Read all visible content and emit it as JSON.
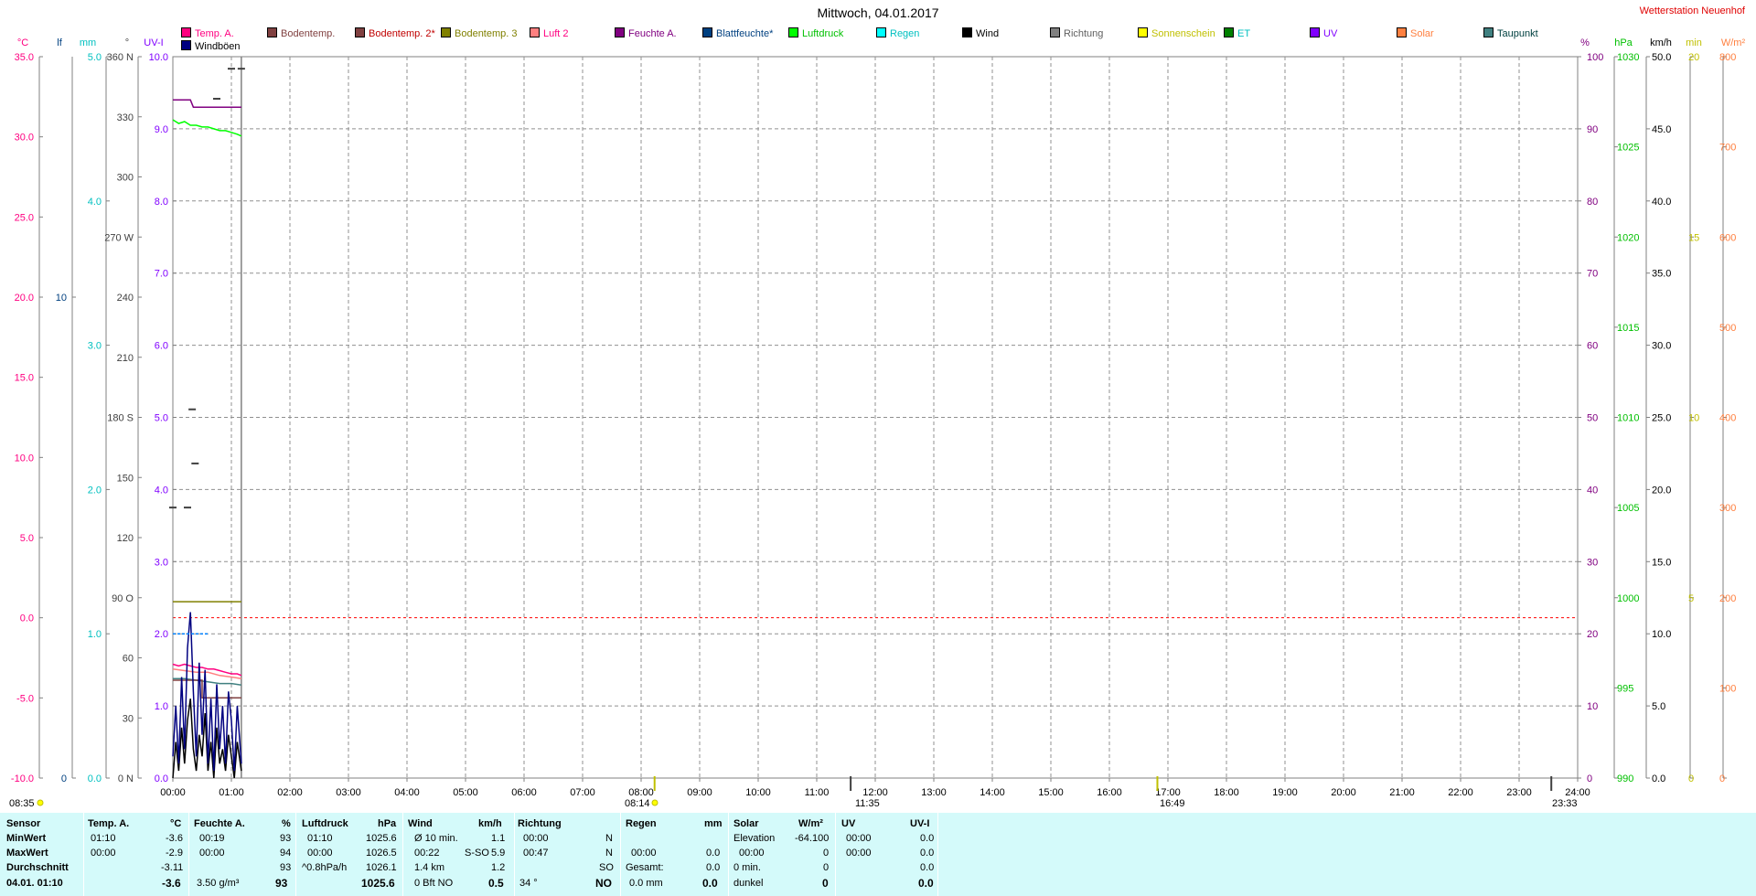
{
  "title": "Mittwoch, 04.01.2017",
  "station": "Wetterstation Neuenhof",
  "legend": [
    {
      "label": "Temp. A.",
      "color": "#ff0080",
      "text_color": "#ff0080"
    },
    {
      "label": "Windböen",
      "color": "#000080",
      "text_color": "#000000"
    },
    {
      "label": "Bodentemp.",
      "color": "#804040",
      "text_color": "#804040"
    },
    {
      "label": "Bodentemp. 2*",
      "color": "#804040",
      "text_color": "#c00000"
    },
    {
      "label": "Bodentemp. 3",
      "color": "#808000",
      "text_color": "#808000"
    },
    {
      "label": "Luft 2",
      "color": "#ff8080",
      "text_color": "#ff0080"
    },
    {
      "label": "Feuchte A.",
      "color": "#800080",
      "text_color": "#800080"
    },
    {
      "label": "Blattfeuchte*",
      "color": "#004080",
      "text_color": "#004080"
    },
    {
      "label": "Luftdruck",
      "color": "#00ff00",
      "text_color": "#00c000"
    },
    {
      "label": "Regen",
      "color": "#00ffff",
      "text_color": "#00c0c0"
    },
    {
      "label": "Wind",
      "color": "#000000",
      "text_color": "#000000"
    },
    {
      "label": "Richtung",
      "color": "#808080",
      "text_color": "#606060"
    },
    {
      "label": "Sonnenschein",
      "color": "#ffff00",
      "text_color": "#c0c000"
    },
    {
      "label": "ET",
      "color": "#008000",
      "text_color": "#00c0c0"
    },
    {
      "label": "UV",
      "color": "#8000ff",
      "text_color": "#8000ff"
    },
    {
      "label": "Solar",
      "color": "#ff8040",
      "text_color": "#ff8040"
    },
    {
      "label": "Taupunkt",
      "color": "#408080",
      "text_color": "#004040"
    }
  ],
  "axes": {
    "temp": {
      "unit": "°C",
      "ticks": [
        "35.0",
        "30.0",
        "25.0",
        "20.0",
        "15.0",
        "10.0",
        "5.0",
        "0.0",
        "-5.0",
        "-10.0"
      ],
      "color": "#ff0080"
    },
    "lf": {
      "unit": "lf",
      "ticks": [
        "10",
        "0"
      ],
      "color": "#004080"
    },
    "rain": {
      "unit": "mm",
      "ticks": [
        "5.0",
        "4.0",
        "3.0",
        "2.0",
        "1.0",
        "0.0"
      ],
      "color": "#00c0c0"
    },
    "dir": {
      "unit": "°",
      "ticks": [
        "360 N",
        "330",
        "300",
        "270 W",
        "240",
        "210",
        "180 S",
        "150",
        "120",
        "90 O",
        "60",
        "30",
        "0 N"
      ],
      "color": "#404040"
    },
    "uvi": {
      "unit": "UV-I",
      "ticks": [
        "10.0",
        "9.0",
        "8.0",
        "7.0",
        "6.0",
        "5.0",
        "4.0",
        "3.0",
        "2.0",
        "1.0",
        "0.0"
      ],
      "color": "#8000ff"
    },
    "hum": {
      "unit": "%",
      "ticks": [
        "100",
        "90",
        "80",
        "70",
        "60",
        "50",
        "40",
        "30",
        "20",
        "10",
        "0"
      ],
      "color": "#800080"
    },
    "press": {
      "unit": "hPa",
      "ticks": [
        "1030",
        "1025",
        "1020",
        "1015",
        "1010",
        "1005",
        "1000",
        "995",
        "990"
      ],
      "color": "#00c000"
    },
    "wind": {
      "unit": "km/h",
      "ticks": [
        "50.0",
        "45.0",
        "40.0",
        "35.0",
        "30.0",
        "25.0",
        "20.0",
        "15.0",
        "10.0",
        "5.0",
        "0.0"
      ],
      "color": "#000000"
    },
    "sun": {
      "unit": "min",
      "ticks": [
        "20",
        "15",
        "10",
        "5",
        "0"
      ],
      "color": "#c0c000"
    },
    "solar": {
      "unit": "W/m²",
      "ticks": [
        "800",
        "700",
        "600",
        "500",
        "400",
        "300",
        "200",
        "100",
        "0"
      ],
      "color": "#ff8040"
    }
  },
  "time_ticks": [
    "00:00",
    "01:00",
    "02:00",
    "03:00",
    "04:00",
    "05:00",
    "06:00",
    "07:00",
    "08:00",
    "09:00",
    "10:00",
    "11:00",
    "12:00",
    "13:00",
    "14:00",
    "15:00",
    "16:00",
    "17:00",
    "18:00",
    "19:00",
    "20:00",
    "21:00",
    "22:00",
    "23:00",
    "24:00"
  ],
  "time_markers": {
    "left": "08:35",
    "sunrise": "08:14",
    "noon": "11:35",
    "sunset": "16:49",
    "right": "23:33"
  },
  "chart_data": {
    "type": "line",
    "x_unit": "hours",
    "xlim": [
      0,
      24
    ],
    "now_hours": 1.17,
    "frost_line_celsius": 0.0,
    "series": [
      {
        "name": "Temp. A.",
        "axis": "temp",
        "color": "#ff0080",
        "x": [
          0,
          0.1,
          0.2,
          0.3,
          0.4,
          0.5,
          0.6,
          0.7,
          0.8,
          0.9,
          1.0,
          1.1,
          1.17
        ],
        "y": [
          -2.9,
          -3.0,
          -2.9,
          -3.0,
          -3.1,
          -3.1,
          -3.2,
          -3.2,
          -3.3,
          -3.4,
          -3.5,
          -3.5,
          -3.6
        ]
      },
      {
        "name": "Luft 2",
        "axis": "temp",
        "color": "#ff8080",
        "x": [
          0,
          0.2,
          0.4,
          0.6,
          0.8,
          1.0,
          1.17
        ],
        "y": [
          -3.2,
          -3.3,
          -3.4,
          -3.4,
          -3.6,
          -3.7,
          -3.8
        ]
      },
      {
        "name": "Taupunkt",
        "axis": "temp",
        "color": "#408080",
        "x": [
          0,
          0.2,
          0.4,
          0.6,
          0.8,
          1.0,
          1.17
        ],
        "y": [
          -3.8,
          -3.8,
          -3.9,
          -4.0,
          -4.1,
          -4.1,
          -4.2
        ]
      },
      {
        "name": "Bodentemp.",
        "axis": "temp",
        "color": "#804040",
        "x": [
          0,
          0.5,
          0.5,
          1.17
        ],
        "y": [
          -3.9,
          -3.9,
          -5.0,
          -5.0
        ]
      },
      {
        "name": "Bodentemp. 3",
        "axis": "temp",
        "color": "#808000",
        "x": [
          0,
          1.17
        ],
        "y": [
          1.0,
          1.0
        ]
      },
      {
        "name": "Feuchte A.",
        "axis": "hum",
        "color": "#800080",
        "x": [
          0,
          0.3,
          0.35,
          0.8,
          1.17
        ],
        "y": [
          94,
          94,
          93,
          93,
          93
        ]
      },
      {
        "name": "Luftdruck",
        "axis": "press",
        "color": "#00ff00",
        "x": [
          0,
          0.1,
          0.2,
          0.3,
          0.4,
          0.5,
          0.6,
          0.7,
          0.8,
          0.9,
          1.0,
          1.1,
          1.17
        ],
        "y": [
          1026.5,
          1026.3,
          1026.4,
          1026.2,
          1026.2,
          1026.1,
          1026.1,
          1026.0,
          1025.9,
          1025.9,
          1025.8,
          1025.7,
          1025.6
        ]
      },
      {
        "name": "Wind",
        "axis": "wind",
        "color": "#000000",
        "x": [
          0,
          0.05,
          0.1,
          0.15,
          0.2,
          0.25,
          0.3,
          0.35,
          0.4,
          0.45,
          0.5,
          0.55,
          0.6,
          0.65,
          0.7,
          0.75,
          0.8,
          0.85,
          0.9,
          0.95,
          1.0,
          1.05,
          1.1,
          1.17
        ],
        "y": [
          0,
          2.5,
          0.5,
          3.5,
          1.0,
          4.0,
          5.5,
          2.0,
          0.5,
          3.0,
          1.5,
          4.5,
          0.5,
          2.5,
          0,
          3.5,
          1.0,
          2.0,
          0.5,
          3.0,
          1.5,
          0,
          2.5,
          0.5
        ]
      },
      {
        "name": "Windböen",
        "axis": "wind",
        "color": "#000080",
        "x": [
          0,
          0.05,
          0.1,
          0.15,
          0.2,
          0.25,
          0.3,
          0.35,
          0.4,
          0.45,
          0.5,
          0.55,
          0.6,
          0.65,
          0.7,
          0.75,
          0.8,
          0.85,
          0.9,
          0.95,
          1.0,
          1.05,
          1.1,
          1.17
        ],
        "y": [
          1.5,
          5.0,
          1.0,
          7.0,
          2.0,
          9.0,
          11.5,
          6.0,
          1.5,
          8.0,
          3.0,
          7.5,
          1.0,
          5.5,
          0.5,
          6.5,
          2.0,
          5.0,
          1.0,
          6.0,
          4.0,
          0.5,
          5.0,
          1.0
        ]
      },
      {
        "name": "Richtung",
        "axis": "dir",
        "color": "#404040",
        "points": [
          [
            0,
            135
          ],
          [
            0.25,
            135
          ],
          [
            0.33,
            184
          ],
          [
            0.38,
            157
          ],
          [
            0.75,
            339
          ],
          [
            1.0,
            354
          ],
          [
            1.17,
            354
          ]
        ]
      },
      {
        "name": "Regen",
        "axis": "rain",
        "color": "#0080ff",
        "x": [
          0,
          0.6
        ],
        "y": [
          1.0,
          1.0
        ]
      }
    ]
  },
  "info": {
    "col_sensor": {
      "header": "Sensor",
      "min": "MinWert",
      "max": "MaxWert",
      "avg": "Durchschnitt",
      "now": "04.01. 01:10"
    },
    "temp": {
      "header": "Temp. A.",
      "unit": "°C",
      "min_time": "01:10",
      "min_val": "-3.6",
      "max_time": "00:00",
      "max_val": "-2.9",
      "avg_val": "-3.11",
      "now_val": "-3.6"
    },
    "hum": {
      "header": "Feuchte A.",
      "unit": "%",
      "min_time": "00:19",
      "min_val": "93",
      "max_time": "00:00",
      "max_val": "94",
      "avg_val": "93",
      "abs_hum": "3.50 g/m³",
      "now_val": "93"
    },
    "press": {
      "header": "Luftdruck",
      "unit": "hPa",
      "min_time": "01:10",
      "min_val": "1025.6",
      "max_time": "00:00",
      "max_val": "1026.5",
      "trend": "^0.8hPa/h",
      "avg_val": "1026.1",
      "now_val": "1025.6"
    },
    "wind": {
      "header": "Wind",
      "unit": "km/h",
      "r1_label": "Ø 10 min.",
      "r1_val": "1.1",
      "r2_time": "00:22",
      "r2_dir": "S-SO",
      "r2_val": "5.9",
      "r3_label": "1.4 km",
      "r3_val": "1.2",
      "r4_label": "0 Bft NO",
      "r4_val": "0.5"
    },
    "dir": {
      "header": "Richtung",
      "r1_time": "00:00",
      "r1_val": "N",
      "r2_time": "00:47",
      "r2_val": "N",
      "r3_val": "SO",
      "r4_deg": "34 °",
      "r4_val": "NO"
    },
    "rain": {
      "header": "Regen",
      "unit": "mm",
      "r2_time": "00:00",
      "r2_val": "0.0",
      "r3_label": "Gesamt:",
      "r3_val": "0.0",
      "r4_label": "0.0 mm",
      "r4_val": "0.0"
    },
    "solar": {
      "header": "Solar",
      "unit": "W/m²",
      "r1_label": "Elevation",
      "r1_val": "-64.100",
      "r2_time": "00:00",
      "r2_val": "0",
      "r3_label": "0 min.",
      "r3_val": "0",
      "r4_label": "dunkel",
      "r4_val": "0"
    },
    "uv": {
      "header": "UV",
      "unit": "UV-I",
      "r1_time": "00:00",
      "r1_val": "0.0",
      "r2_time": "00:00",
      "r2_val": "0.0",
      "r3_val": "0.0",
      "r4_val": "0.0"
    }
  }
}
